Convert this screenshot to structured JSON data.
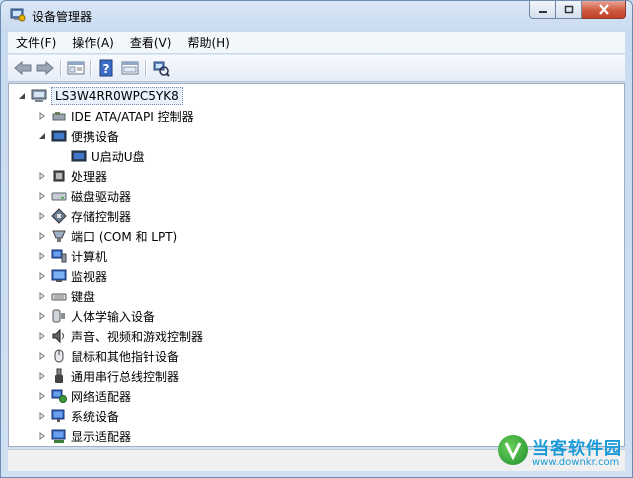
{
  "window": {
    "title": "设备管理器",
    "controls": {
      "minimize": "minimize",
      "maximize": "maximize",
      "close": "close"
    }
  },
  "menu": [
    {
      "label": "文件(F)"
    },
    {
      "label": "操作(A)"
    },
    {
      "label": "查看(V)"
    },
    {
      "label": "帮助(H)"
    }
  ],
  "toolbar": {
    "icons": [
      "back-icon",
      "forward-icon",
      "properties-icon",
      "help-icon",
      "show-hide-icon",
      "scan-hardware-icon"
    ]
  },
  "tree": {
    "root": {
      "label": "LS3W4RR0WPC5YK8",
      "icon": "computer-icon",
      "expanded": true
    },
    "items": [
      {
        "label": "IDE ATA/ATAPI 控制器",
        "icon": "ide-controller-icon",
        "expanded": false
      },
      {
        "label": "便携设备",
        "icon": "portable-device-icon",
        "expanded": true,
        "children": [
          {
            "label": "U启动U盘",
            "icon": "portable-device-icon"
          }
        ]
      },
      {
        "label": "处理器",
        "icon": "processor-icon",
        "expanded": false
      },
      {
        "label": "磁盘驱动器",
        "icon": "disk-drive-icon",
        "expanded": false
      },
      {
        "label": "存储控制器",
        "icon": "storage-controller-icon",
        "expanded": false
      },
      {
        "label": "端口 (COM 和 LPT)",
        "icon": "port-icon",
        "expanded": false
      },
      {
        "label": "计算机",
        "icon": "computer-icon",
        "expanded": false
      },
      {
        "label": "监视器",
        "icon": "monitor-icon",
        "expanded": false
      },
      {
        "label": "键盘",
        "icon": "keyboard-icon",
        "expanded": false
      },
      {
        "label": "人体学输入设备",
        "icon": "hid-icon",
        "expanded": false
      },
      {
        "label": "声音、视频和游戏控制器",
        "icon": "sound-icon",
        "expanded": false
      },
      {
        "label": "鼠标和其他指针设备",
        "icon": "mouse-icon",
        "expanded": false
      },
      {
        "label": "通用串行总线控制器",
        "icon": "usb-icon",
        "expanded": false
      },
      {
        "label": "网络适配器",
        "icon": "network-adapter-icon",
        "expanded": false
      },
      {
        "label": "系统设备",
        "icon": "system-device-icon",
        "expanded": false
      },
      {
        "label": "显示适配器",
        "icon": "display-adapter-icon",
        "expanded": false
      }
    ]
  },
  "watermark": {
    "title": "当客软件园",
    "url": "www.downkr.com"
  }
}
